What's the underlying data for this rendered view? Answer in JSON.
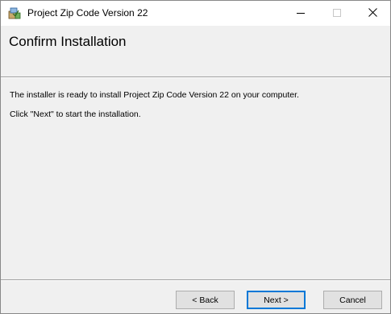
{
  "window": {
    "title": "Project Zip Code Version 22",
    "minimize_glyph": "—",
    "close_glyph": "✕"
  },
  "banner": {
    "title": "Confirm Installation"
  },
  "content": {
    "line1": "The installer is ready to install Project Zip Code Version 22 on your computer.",
    "line2": "Click \"Next\" to start the installation."
  },
  "buttons": {
    "back": "< Back",
    "next": "Next >",
    "cancel": "Cancel"
  },
  "colors": {
    "accent": "#0078d7",
    "background": "#f0f0f0"
  }
}
